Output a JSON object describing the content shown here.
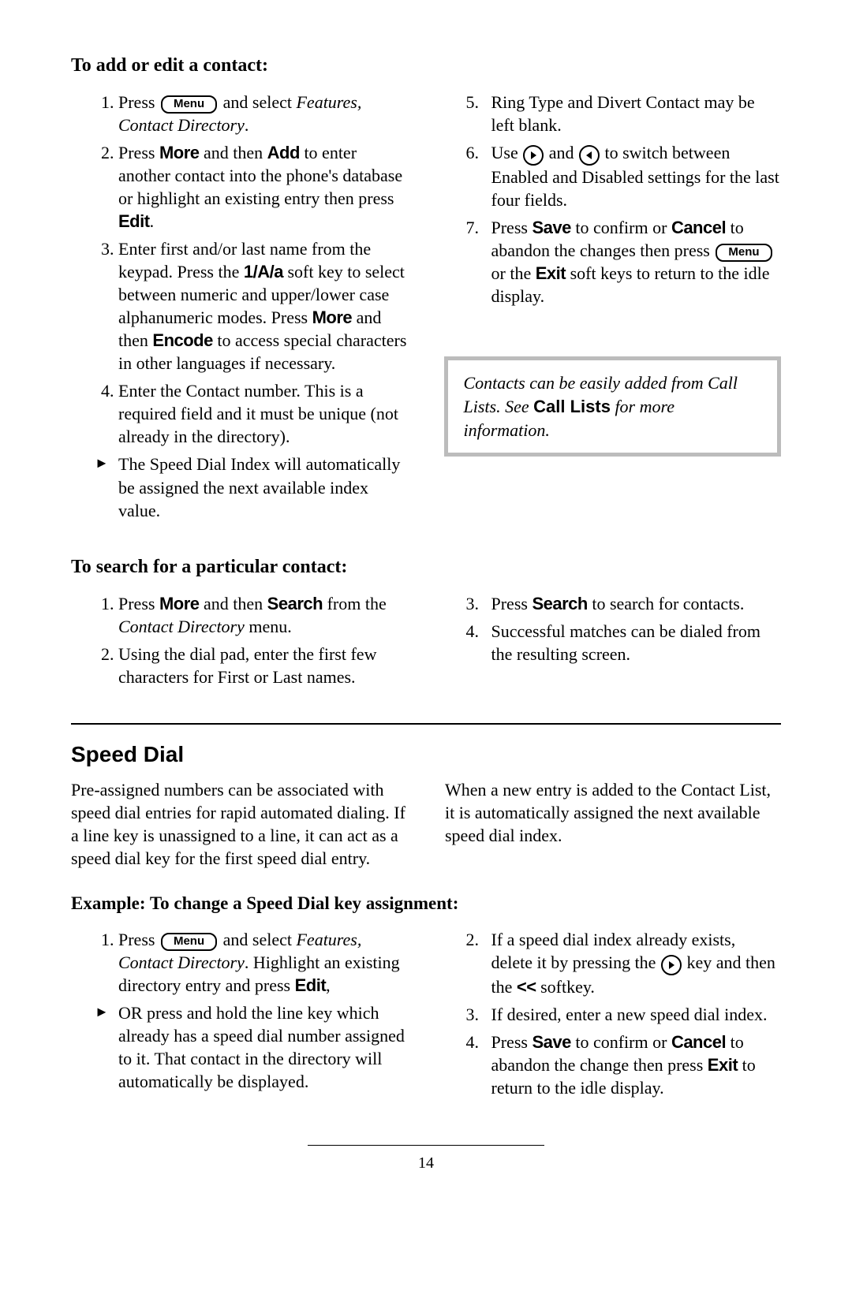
{
  "addEdit": {
    "heading": "To add or edit a contact:",
    "left": {
      "s1a": "Press ",
      "menu": "Menu",
      "s1b": " and select ",
      "s1c": "Features, Contact Directory",
      "s1d": ".",
      "s2a": "Press ",
      "more": "More",
      "s2b": " and then ",
      "add": "Add",
      "s2c": " to enter another contact into the phone's database or highlight an existing entry then press ",
      "edit": "Edit",
      "s2d": ".",
      "s3a": "Enter first and/or last name from the keypad.  Press the ",
      "oneAa": "1/A/a",
      "s3b": " soft key to select between numeric and upper/lower case alphanumeric modes. Press ",
      "s3c": " and then ",
      "encode": "Encode",
      "s3d": "  to access special characters in other languages if necessary.",
      "s4": "Enter the Contact number.  This is a required field and it must be unique (not already in the directory).",
      "tri": "The Speed Dial Index will automatically be assigned the next available index value."
    },
    "right": {
      "s5": "Ring Type and Divert Contact may be left blank.",
      "s6a": "Use ",
      "s6b": " and ",
      "s6c": " to switch between Enabled and Disabled settings for the last four fields.",
      "s7a": "Press ",
      "save": "Save",
      "s7b": " to confirm or ",
      "cancel": "Cancel",
      "s7c": " to abandon the changes then press ",
      "s7d": " or the ",
      "exit": "Exit",
      "s7e": " soft keys to return to the idle display."
    },
    "note": {
      "t1": "Contacts can be easily added from Call Lists.  See ",
      "bold": "Call Lists",
      "t2": " for more information."
    }
  },
  "search": {
    "heading": "To search for a particular contact:",
    "left": {
      "s1a": "Press ",
      "more": "More",
      "s1b": " and then ",
      "srch": "Search",
      "s1c": " from the ",
      "cd": "Contact Directory",
      "s1d": " menu.",
      "s2": "Using the dial pad, enter the first few characters for First or Last names."
    },
    "right": {
      "s3a": "Press ",
      "srch": "Search",
      "s3b": " to search for contacts.",
      "s4": "Successful matches can be dialed from the resulting screen."
    }
  },
  "speed": {
    "heading": "Speed Dial",
    "para": "Pre-assigned numbers can be associated with speed dial entries for rapid automated dialing.  If a line key is unassigned to a line, it can act as a speed dial key for the first speed dial entry.  When a new entry is added to the Contact List, it is automatically assigned the next available speed dial index.",
    "example": {
      "heading": "Example: To change a Speed Dial key assignment:",
      "left": {
        "s1a": "Press ",
        "menu": "Menu",
        "s1b": " and select ",
        "fcd": "Features, Contact Directory",
        "s1c": ".  Highlight an existing directory entry and press ",
        "edit": "Edit",
        "s1d": ",",
        "tri": "OR press and hold the line key which already has a speed dial number assigned to it.  That contact in the directory will automatically be displayed."
      },
      "right": {
        "s2a": "If a speed dial index already exists, delete it by pressing the ",
        "s2b": " key and then the ",
        "ll": "<<",
        "s2c": " softkey.",
        "s3": "If desired, enter a new speed dial index.",
        "s4a": "Press ",
        "save": "Save",
        "s4b": " to confirm or ",
        "cancel": "Cancel",
        "s4c": " to abandon the change then press ",
        "exit": "Exit",
        "s4d": " to return to the idle display."
      }
    }
  },
  "pageNumber": "14"
}
